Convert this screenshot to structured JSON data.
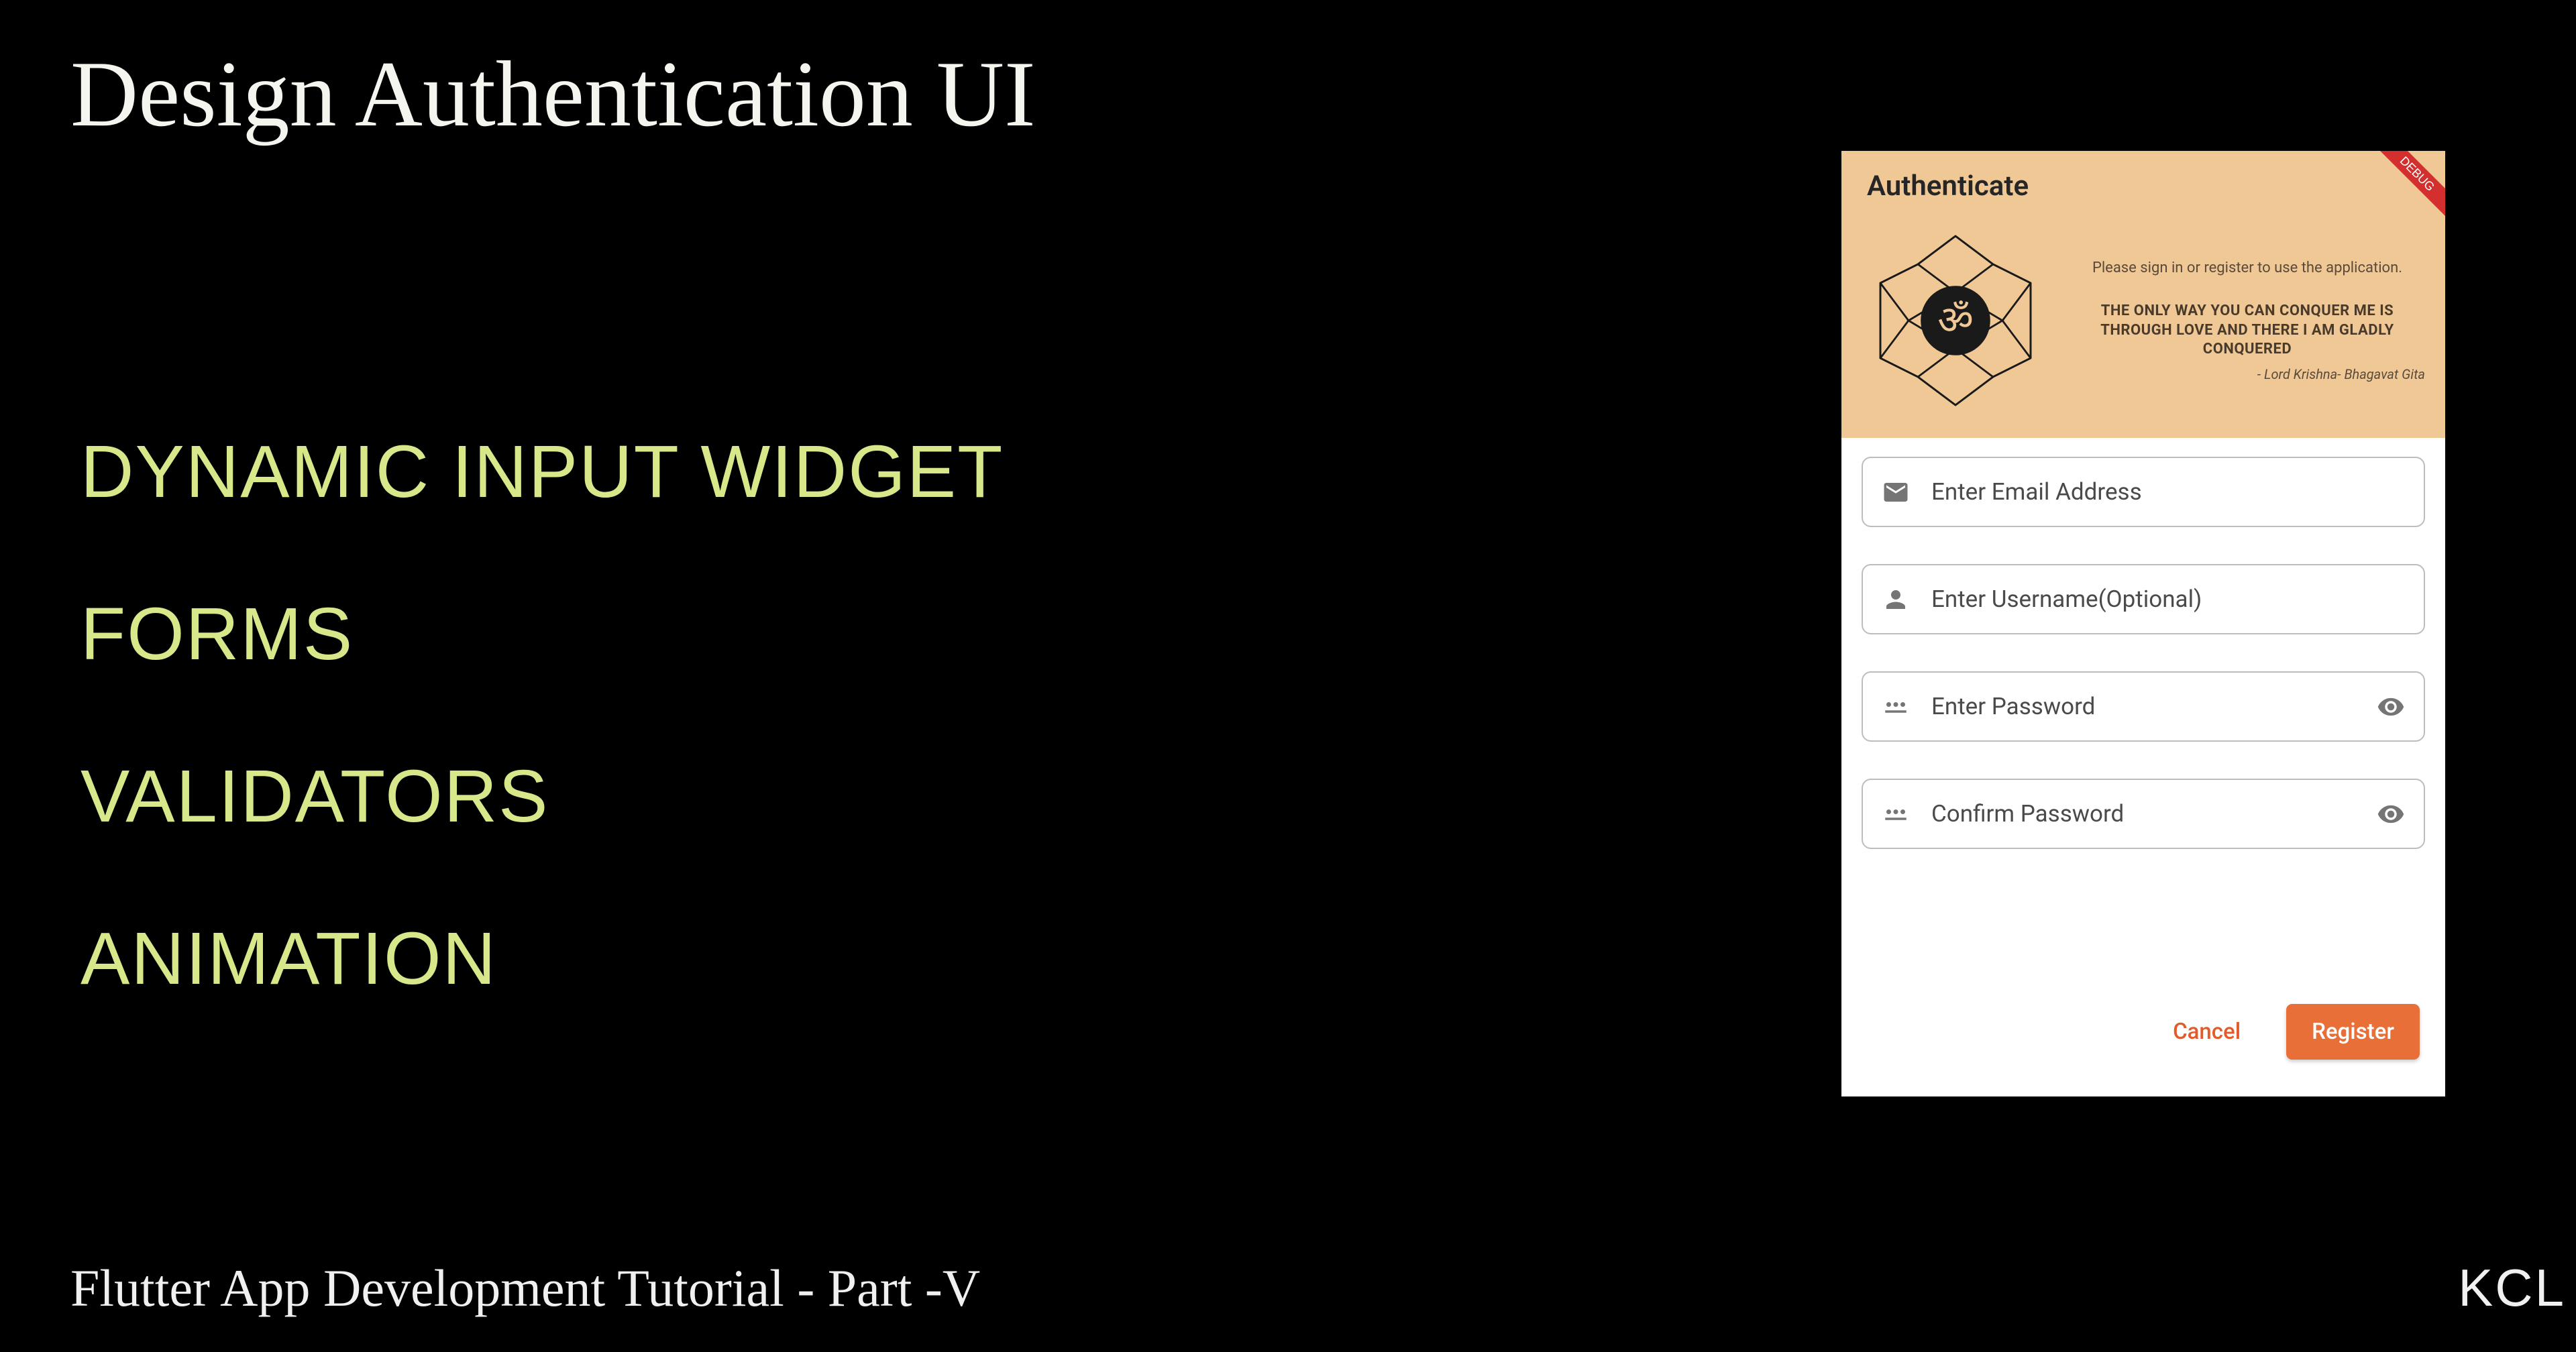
{
  "title": "Design Authentication UI",
  "bullets": {
    "b1": "DYNAMIC INPUT WIDGET",
    "b2": "FORMS",
    "b3": "VALIDATORS",
    "b4": "ANIMATION"
  },
  "footer": "Flutter App Development Tutorial - Part -V",
  "brand": "KCL",
  "phone": {
    "appbar_title": "Authenticate",
    "hero": {
      "subtitle": "Please sign in or register to use the application.",
      "quote": "THE ONLY WAY YOU CAN CONQUER ME IS THROUGH LOVE AND THERE I AM GLADLY CONQUERED",
      "attribution": "- Lord Krishna- Bhagavat Gita"
    },
    "inputs": {
      "email": "Enter Email Address",
      "username": "Enter Username(Optional)",
      "password": "Enter Password",
      "confirm": "Confirm Password"
    },
    "buttons": {
      "cancel": "Cancel",
      "register": "Register"
    }
  }
}
